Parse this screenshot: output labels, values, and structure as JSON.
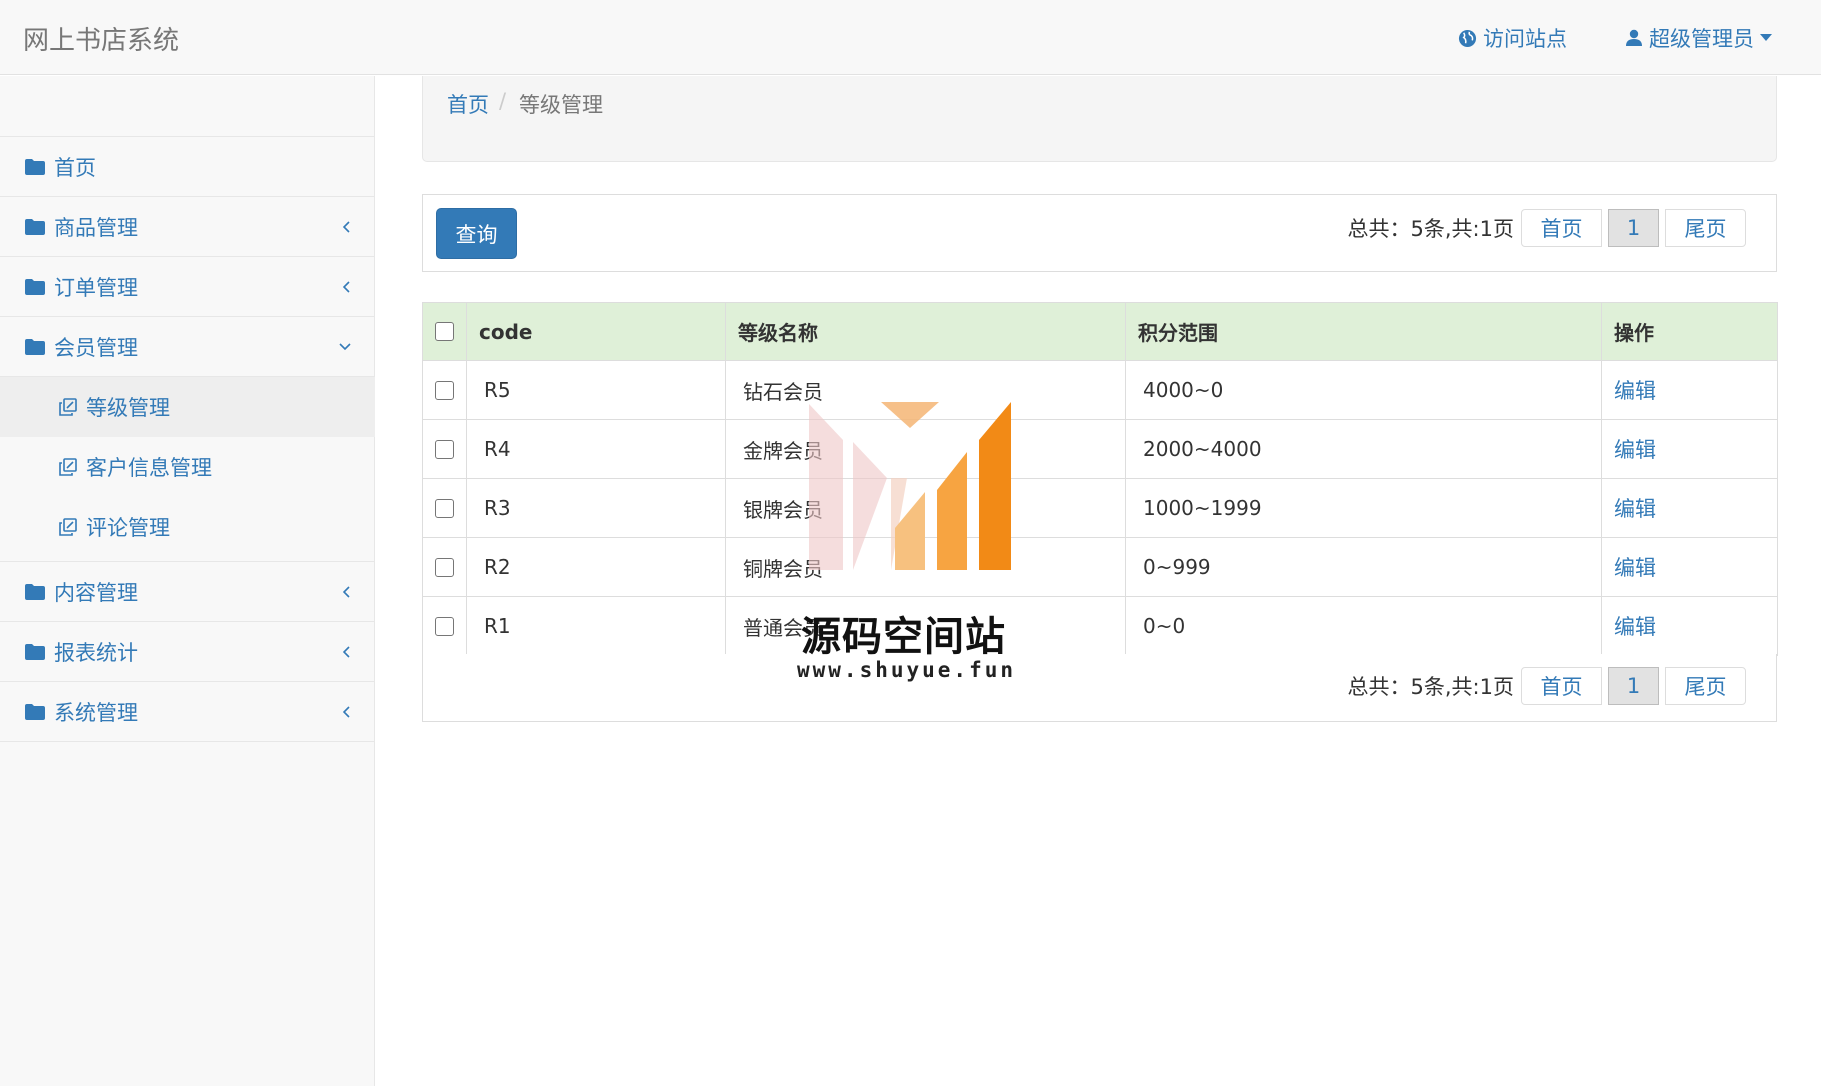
{
  "app": {
    "title": "网上书店系统"
  },
  "header": {
    "visit_site": "访问站点",
    "user_menu": "超级管理员"
  },
  "sidebar": {
    "items": [
      {
        "label": "首页",
        "has_chevron": false
      },
      {
        "label": "商品管理",
        "chevron": "left"
      },
      {
        "label": "订单管理",
        "chevron": "left"
      },
      {
        "label": "会员管理",
        "chevron": "down"
      },
      {
        "label": "内容管理",
        "chevron": "left"
      },
      {
        "label": "报表统计",
        "chevron": "left"
      },
      {
        "label": "系统管理",
        "chevron": "left"
      }
    ],
    "sub_items": [
      {
        "label": "等级管理",
        "active": true
      },
      {
        "label": "客户信息管理",
        "active": false
      },
      {
        "label": "评论管理",
        "active": false
      }
    ]
  },
  "breadcrumb": {
    "home": "首页",
    "separator": "/",
    "current": "等级管理"
  },
  "toolbar": {
    "query_button": "查询"
  },
  "pagination": {
    "summary": "总共：5条,共:1页",
    "first": "首页",
    "current_page": "1",
    "last": "尾页"
  },
  "table": {
    "columns": [
      "code",
      "等级名称",
      "积分范围",
      "操作"
    ],
    "rows": [
      {
        "code": "R5",
        "name": "钻石会员",
        "range": "4000~0",
        "action": "编辑"
      },
      {
        "code": "R4",
        "name": "金牌会员",
        "range": "2000~4000",
        "action": "编辑"
      },
      {
        "code": "R3",
        "name": "银牌会员",
        "range": "1000~1999",
        "action": "编辑"
      },
      {
        "code": "R2",
        "name": "铜牌会员",
        "range": "0~999",
        "action": "编辑"
      },
      {
        "code": "R1",
        "name": "普通会员",
        "range": "0~0",
        "action": "编辑"
      }
    ]
  },
  "watermark": {
    "title": "源码空间站",
    "url": "www.shuyue.fun"
  },
  "colors": {
    "link": "#337ab7",
    "header_row": "#dff0d8",
    "sidebar_bg": "#f8f8f8",
    "active_sub": "#eeeeee"
  },
  "icons": {
    "folder": "folder-icon",
    "sub": "copy-icon",
    "globe": "globe-icon",
    "user": "user-icon"
  }
}
